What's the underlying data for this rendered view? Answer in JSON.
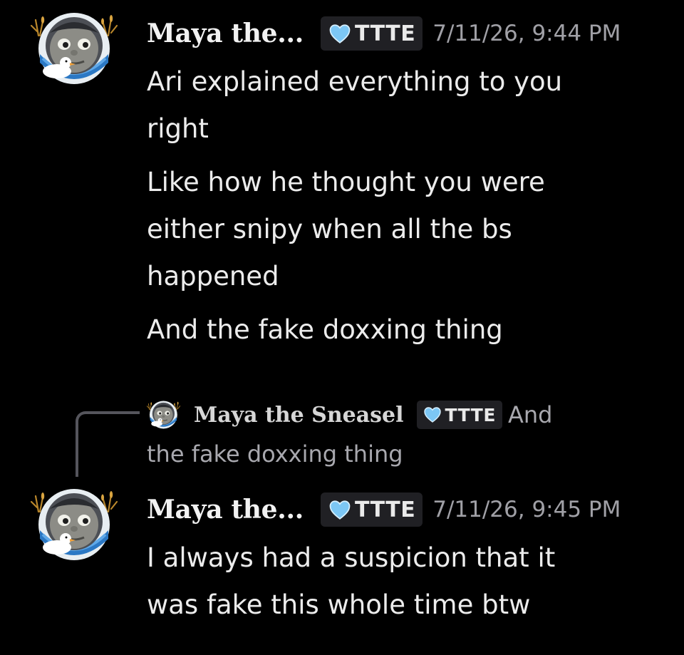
{
  "messages": [
    {
      "username": "Maya the...",
      "tag": "TTTE",
      "timestamp": "7/11/26, 9:44 PM",
      "lines": [
        "Ari explained everything to you",
        "right",
        "Like how he thought you were",
        "either snipy when all the bs",
        "happened",
        "And the fake doxxing thing"
      ]
    },
    {
      "reply": {
        "username": "Maya the Sneasel",
        "tag": "TTTE",
        "snippet_start": "And",
        "snippet_rest": "the fake doxxing thing"
      },
      "username": "Maya the...",
      "tag": "TTTE",
      "timestamp": "7/11/26, 9:45 PM",
      "lines": [
        "I always had a suspicion that it",
        "was fake this whole time btw"
      ]
    }
  ],
  "colors": {
    "background": "#000000",
    "tag_background": "#202024",
    "heart": "#7cc7f5",
    "timestamp": "#a0a0a6",
    "reply_line": "#55555c"
  },
  "icons": {
    "avatar": "train-face-duck-avatar",
    "tag_icon": "blue-heart-icon"
  }
}
